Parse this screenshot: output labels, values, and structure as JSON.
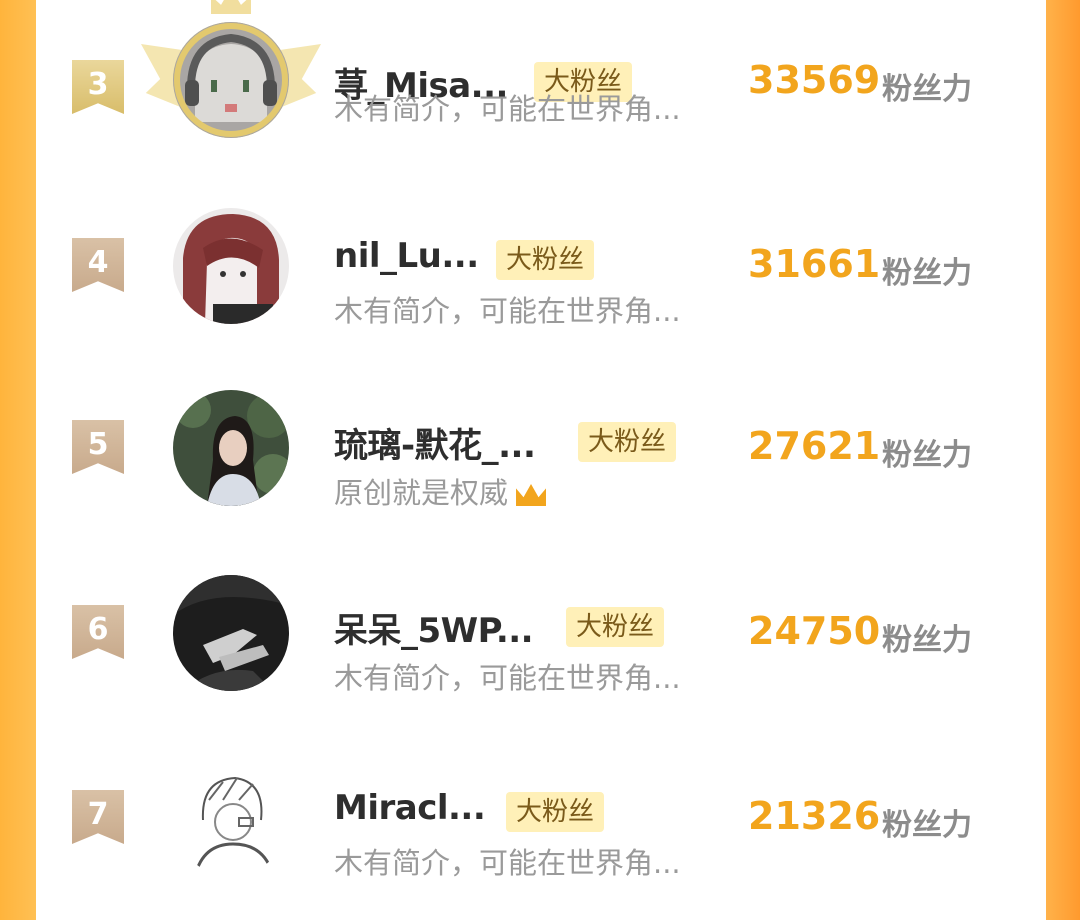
{
  "leaderboard": {
    "score_unit": "粉丝力",
    "badge_label": "大粉丝",
    "rows": [
      {
        "rank": "3",
        "name": "荨_Misa...",
        "bio": "木有简介，可能在世界角...",
        "score": "33569",
        "has_gold_frame": true,
        "avatar": "gray-cat-headphones-avatar"
      },
      {
        "rank": "4",
        "name": "nil_Lu...",
        "bio": "木有简介，可能在世界角...",
        "score": "31661",
        "avatar": "red-hair-girl-avatar"
      },
      {
        "rank": "5",
        "name": "琉璃-默花_...",
        "bio": "原创就是权威",
        "bio_emoji": "crown-emoji",
        "score": "27621",
        "avatar": "girl-forest-photo-avatar"
      },
      {
        "rank": "6",
        "name": "呆呆_5WP...",
        "bio": "木有简介，可能在世界角...",
        "score": "24750",
        "avatar": "dark-hands-photo-avatar"
      },
      {
        "rank": "7",
        "name": "Miracl...",
        "bio": "木有简介，可能在世界角...",
        "score": "21326",
        "avatar": "sketch-boy-avatar"
      }
    ]
  },
  "colors": {
    "score": "#f2a51d",
    "badge_bg": "#fff0b8",
    "rank_ribbon": "#c8aa8c",
    "rank_ribbon_gold": "#d8bd6a",
    "side_accent": "#ffb43c"
  }
}
